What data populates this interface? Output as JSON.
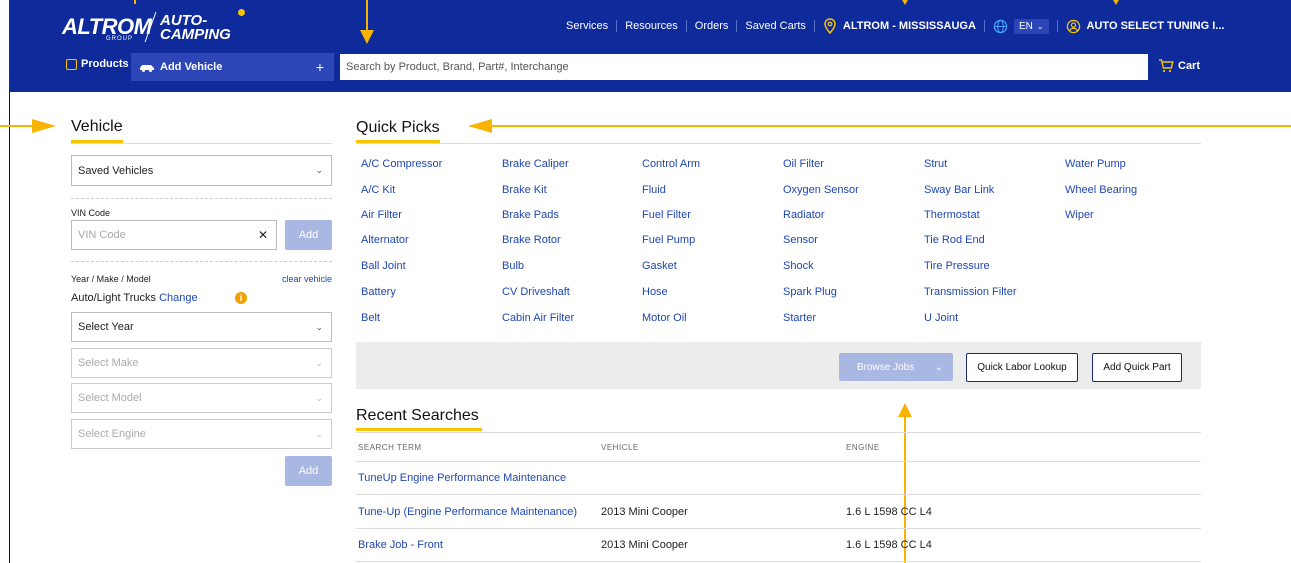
{
  "header": {
    "logo_primary": "ALTROM",
    "logo_primary_sub": "GROUP",
    "logo_secondary_line1": "AUTO-",
    "logo_secondary_line2": "CAMPING",
    "nav": [
      "Services",
      "Resources",
      "Orders",
      "Saved Carts"
    ],
    "location": "ALTROM - MISSISSAUGA",
    "language": "EN",
    "account": "AUTO SELECT TUNING I...",
    "products_label": "Products",
    "add_vehicle_label": "Add Vehicle",
    "add_vehicle_plus": "+",
    "search_placeholder": "Search by Product, Brand, Part#, Interchange",
    "cart_label": "Cart"
  },
  "vehicle_panel": {
    "title": "Vehicle",
    "saved_vehicles": "Saved Vehicles",
    "vin_label": "VIN Code",
    "vin_placeholder": "VIN Code",
    "vin_clear": "✕",
    "vin_add": "Add",
    "ymm_label": "Year / Make / Model",
    "clear_vehicle": "clear vehicle",
    "vehicle_type": "Auto/Light Trucks",
    "change_label": "Change",
    "info_glyph": "i",
    "select_year": "Select Year",
    "select_make": "Select Make",
    "select_model": "Select Model",
    "select_engine": "Select Engine",
    "add_label": "Add"
  },
  "quick_picks": {
    "title": "Quick Picks",
    "columns": [
      [
        "A/C Compressor",
        "A/C Kit",
        "Air Filter",
        "Alternator",
        "Ball Joint",
        "Battery",
        "Belt"
      ],
      [
        "Brake Caliper",
        "Brake Kit",
        "Brake Pads",
        "Brake Rotor",
        "Bulb",
        "CV Driveshaft",
        "Cabin Air Filter"
      ],
      [
        "Control Arm",
        "Fluid",
        "Fuel Filter",
        "Fuel Pump",
        "Gasket",
        "Hose",
        "Motor Oil"
      ],
      [
        "Oil Filter",
        "Oxygen Sensor",
        "Radiator",
        "Sensor",
        "Shock",
        "Spark Plug",
        "Starter"
      ],
      [
        "Strut",
        "Sway Bar Link",
        "Thermostat",
        "Tie Rod End",
        "Tire Pressure",
        "Transmission Filter",
        "U Joint"
      ],
      [
        "Water Pump",
        "Wheel Bearing",
        "Wiper"
      ]
    ],
    "browse_jobs": "Browse Jobs",
    "quick_labor": "Quick Labor Lookup",
    "add_quick_part": "Add Quick Part"
  },
  "recent_searches": {
    "title": "Recent Searches",
    "headers": [
      "SEARCH TERM",
      "VEHICLE",
      "ENGINE"
    ],
    "rows": [
      {
        "term": "TuneUp Engine Performance Maintenance",
        "vehicle": "",
        "engine": ""
      },
      {
        "term": "Tune-Up (Engine Performance Maintenance)",
        "vehicle": "2013 Mini Cooper",
        "engine": "1.6 L 1598 CC L4"
      },
      {
        "term": "Brake Job - Front",
        "vehicle": "2013 Mini Cooper",
        "engine": "1.6 L 1598 CC L4"
      }
    ]
  },
  "colors": {
    "header_bg": "#0f2a9a",
    "accent": "#f8c300",
    "link": "#1f47b3",
    "annotation": "#f8b400"
  }
}
